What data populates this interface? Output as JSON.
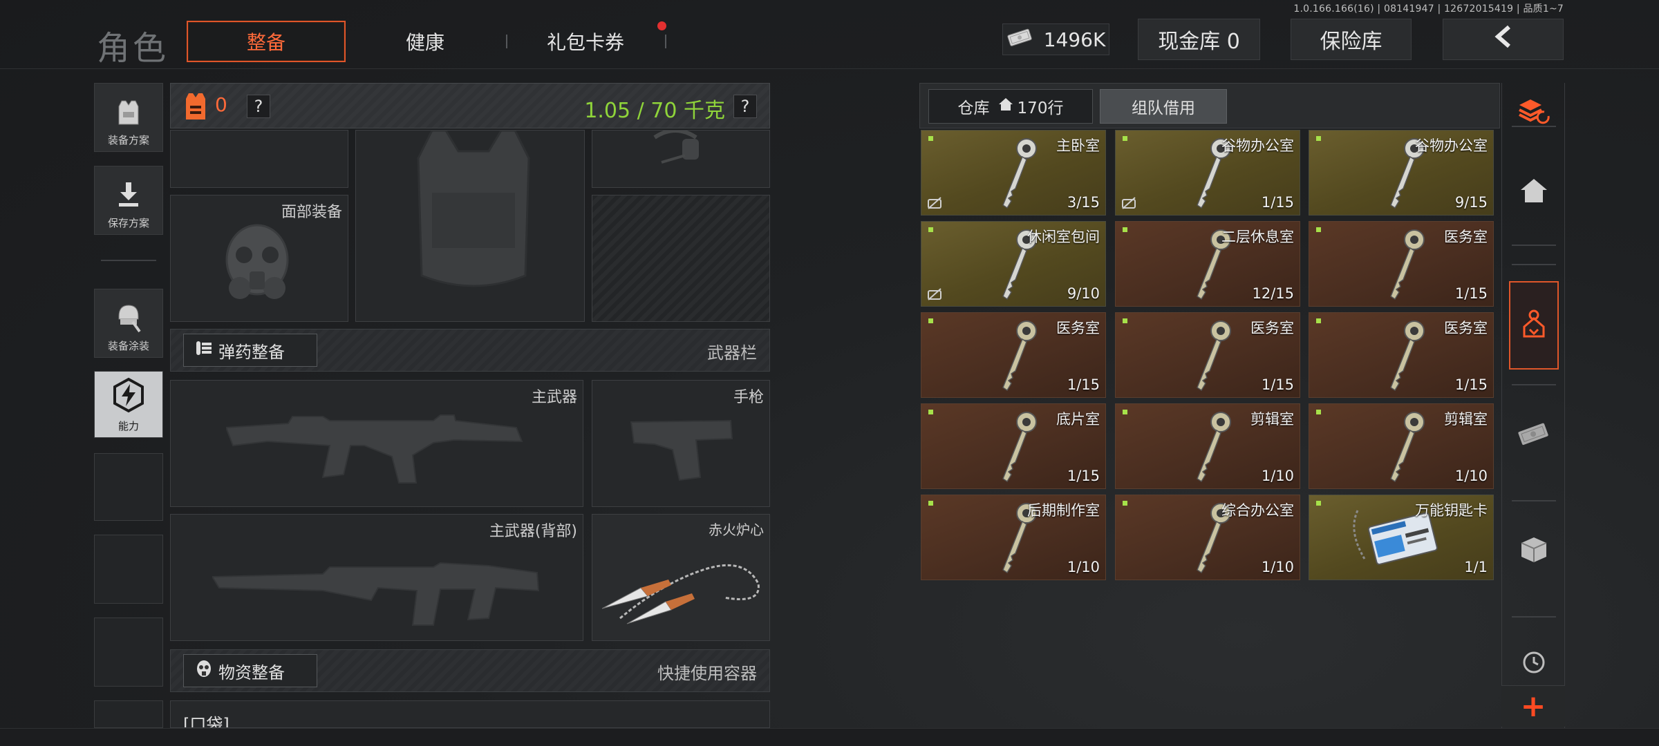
{
  "version": "1.0.166.166(16) | 08141947 | 12672015419 | 品质1~7",
  "header": {
    "title": "角色",
    "tabs": [
      {
        "label": "整备",
        "active": true
      },
      {
        "label": "健康",
        "active": false
      },
      {
        "label": "礼包卡券",
        "active": false,
        "badge": true
      }
    ],
    "currency": "1496K",
    "cash_vault": "现金库 0",
    "insurance": "保险库",
    "back_icon": "chevron-left-icon"
  },
  "left_sidebar": {
    "items": [
      {
        "label": "装备方案",
        "icon": "vest-icon"
      },
      {
        "label": "保存方案",
        "icon": "download-icon"
      },
      {
        "label": "装备涂装",
        "icon": "helmet-icon"
      },
      {
        "label": "能力",
        "icon": "ability-icon",
        "active": true
      }
    ]
  },
  "loadout": {
    "armor_count": "0",
    "help": "?",
    "weight": "1.05 / 70 千克",
    "face_slot": "面部装备",
    "ammo_section": "弹药整备",
    "weapon_bar": "武器栏",
    "primary": "主武器",
    "pistol": "手枪",
    "primary_back": "主武器(背部)",
    "melee": "赤火炉心",
    "supplies_section": "物资整备",
    "quick_container": "快捷使用容器",
    "pocket": "口袋"
  },
  "stash": {
    "tab_stash": "仓库",
    "tab_rows": "170行",
    "tab_team": "组队借用",
    "items": [
      {
        "name": "主卧室",
        "count": "3/15",
        "rarity": "gold",
        "nobuy": true
      },
      {
        "name": "谷物办公室",
        "count": "1/15",
        "rarity": "gold",
        "nobuy": true
      },
      {
        "name": "谷物办公室",
        "count": "9/15",
        "rarity": "gold",
        "nobuy": false
      },
      {
        "name": "休闲室包间",
        "count": "9/10",
        "rarity": "gold",
        "nobuy": true
      },
      {
        "name": "二层休息室",
        "count": "12/15",
        "rarity": "brown",
        "nobuy": false
      },
      {
        "name": "医务室",
        "count": "1/15",
        "rarity": "brown",
        "nobuy": false
      },
      {
        "name": "医务室",
        "count": "1/15",
        "rarity": "brown",
        "nobuy": false
      },
      {
        "name": "医务室",
        "count": "1/15",
        "rarity": "brown",
        "nobuy": false
      },
      {
        "name": "医务室",
        "count": "1/15",
        "rarity": "brown",
        "nobuy": false
      },
      {
        "name": "底片室",
        "count": "1/15",
        "rarity": "brown",
        "nobuy": false
      },
      {
        "name": "剪辑室",
        "count": "1/10",
        "rarity": "brown",
        "nobuy": false
      },
      {
        "name": "剪辑室",
        "count": "1/10",
        "rarity": "brown",
        "nobuy": false
      },
      {
        "name": "后期制作室",
        "count": "1/10",
        "rarity": "brown",
        "nobuy": false
      },
      {
        "name": "综合办公室",
        "count": "1/10",
        "rarity": "brown",
        "nobuy": false
      },
      {
        "name": "万能钥匙卡",
        "count": "1/1",
        "rarity": "gold",
        "nobuy": false
      }
    ]
  },
  "right_rail": {
    "icons": [
      "stack-refresh-icon",
      "home-icon",
      "key-tag-icon",
      "cash-icon",
      "box-icon",
      "clock-icon"
    ],
    "add": "+"
  },
  "colors": {
    "accent": "#ff6a3a",
    "weight_green": "#8fd43a",
    "gold_item": "#5e5427",
    "brown_item": "#4e3022"
  }
}
